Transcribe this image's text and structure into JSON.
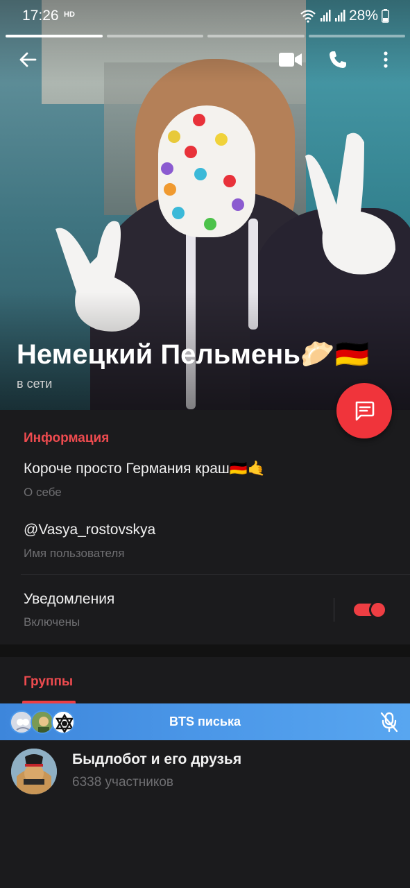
{
  "status_bar": {
    "time": "17:26",
    "hd_badge": "HD",
    "battery": "28%"
  },
  "profile": {
    "name": "Немецкий Пельмень🥟🇩🇪",
    "status": "в сети"
  },
  "info_section": {
    "title": "Информация",
    "bio": "Короче просто Германия краш🇩🇪🤙",
    "bio_label": "О себе",
    "username": "@Vasya_rostovskya",
    "username_label": "Имя пользователя",
    "notifications": "Уведомления",
    "notifications_state": "Включены",
    "notifications_enabled": true
  },
  "groups_section": {
    "title": "Группы"
  },
  "voice_chat": {
    "title": "BTS писька"
  },
  "group_item": {
    "name": "Быдлобот и его друзья",
    "members": "6338 участников"
  },
  "icons": {
    "back": "arrow-left-icon",
    "video": "video-camera-icon",
    "call": "phone-icon",
    "more": "more-vertical-icon",
    "message": "message-icon",
    "mic_off": "mic-off-icon"
  },
  "colors": {
    "accent_red": "#ee3e43",
    "fab": "#f0343b",
    "voice_bar": "#4b97e8",
    "background": "#1b1b1d",
    "secondary_text": "#6f6f72"
  }
}
